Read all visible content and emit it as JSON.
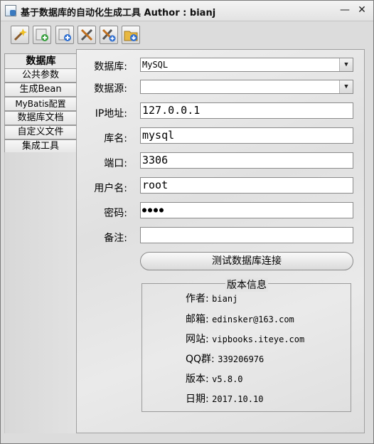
{
  "window": {
    "title": "基于数据库的自动化生成工具 Author : bianj",
    "minimize_glyph": "—",
    "close_glyph": "✕"
  },
  "toolbar": {
    "buttons": [
      "wand-icon",
      "add-green-icon",
      "add-blue-icon",
      "tools-icon",
      "tools-add-icon",
      "folder-down-icon"
    ]
  },
  "tabs": [
    "数据库",
    "公共参数",
    "生成Bean",
    "MyBatis配置",
    "数据库文档",
    "自定义文件",
    "集成工具"
  ],
  "form": {
    "db_label": "数据库:",
    "db_value": "MySQL",
    "ds_label": "数据源:",
    "ds_value": "",
    "ip_label": "IP地址:",
    "ip_value": "127.0.0.1",
    "name_label": "库名:",
    "name_value": "mysql",
    "port_label": "端口:",
    "port_value": "3306",
    "user_label": "用户名:",
    "user_value": "root",
    "pwd_label": "密码:",
    "pwd_value": "●●●●",
    "note_label": "备注:",
    "note_value": "",
    "test_button": "测试数据库连接"
  },
  "version_info": {
    "legend": "版本信息",
    "rows": [
      {
        "label": "作者:",
        "value": "bianj"
      },
      {
        "label": "邮箱:",
        "value": "edinsker@163.com"
      },
      {
        "label": "网站:",
        "value": "vipbooks.iteye.com"
      },
      {
        "label": "QQ群:",
        "value": "339206976"
      },
      {
        "label": "版本:",
        "value": "v5.8.0"
      },
      {
        "label": "日期:",
        "value": "2017.10.10"
      }
    ]
  }
}
